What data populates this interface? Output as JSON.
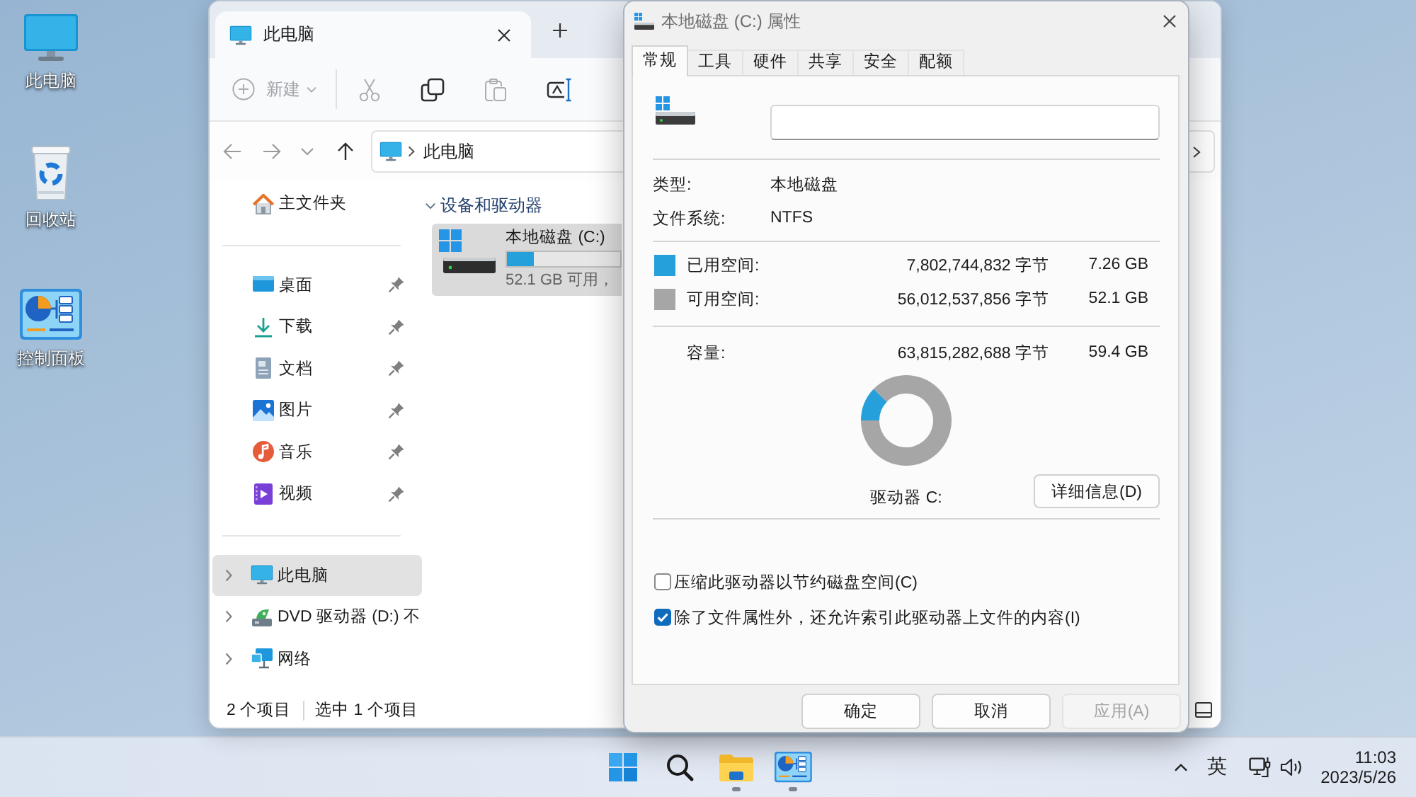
{
  "desktop": {
    "shortcuts": [
      {
        "label": "此电脑",
        "kind": "computer"
      },
      {
        "label": "回收站",
        "kind": "recycle-bin"
      },
      {
        "label": "控制面板",
        "kind": "control-panel"
      }
    ]
  },
  "explorer": {
    "tabs": [
      {
        "title": "此电脑",
        "selected": true
      }
    ],
    "toolbar": {
      "new": {
        "label": "新建",
        "disabled": true
      },
      "actions": [
        {
          "kind": "cut",
          "disabled": true
        },
        {
          "kind": "copy",
          "disabled": false
        },
        {
          "kind": "paste",
          "disabled": true
        },
        {
          "kind": "rename",
          "disabled": false
        }
      ]
    },
    "nav": [
      {
        "kind": "back",
        "disabled": true
      },
      {
        "kind": "forward",
        "disabled": true
      },
      {
        "kind": "recent",
        "disabled": true
      },
      {
        "kind": "up",
        "disabled": false
      }
    ],
    "address": {
      "path": "此电脑"
    },
    "sidebar": {
      "sections": [
        {
          "items": [
            {
              "label": "主文件夹",
              "kind": "home",
              "selected": false
            }
          ]
        },
        {
          "items": [
            {
              "label": "桌面",
              "kind": "desktop",
              "pinned": true,
              "selected": false
            },
            {
              "label": "下载",
              "kind": "downloads",
              "pinned": true,
              "selected": false
            },
            {
              "label": "文档",
              "kind": "documents",
              "pinned": true,
              "selected": false
            },
            {
              "label": "图片",
              "kind": "pictures",
              "pinned": true,
              "selected": false
            },
            {
              "label": "音乐",
              "kind": "music",
              "pinned": true,
              "selected": false
            },
            {
              "label": "视频",
              "kind": "videos",
              "pinned": true,
              "selected": false
            }
          ]
        },
        {
          "items": [
            {
              "label": "此电脑",
              "kind": "computer",
              "expanded": false,
              "selected": true
            },
            {
              "label": "DVD 驱动器 (D:) 不",
              "kind": "dvd",
              "expanded": false,
              "selected": false
            },
            {
              "label": "网络",
              "kind": "network",
              "expanded": false,
              "selected": false
            }
          ]
        }
      ]
    },
    "groups": [
      {
        "title": "设备和驱动器",
        "expanded": true,
        "drives": [
          {
            "name": "本地磁盘 (C:)",
            "free": "52.1 GB 可用，",
            "level": 0.24,
            "selected": true
          }
        ]
      }
    ],
    "status_bar": {
      "items": "2 个项目",
      "selection": "选中 1 个项目"
    }
  },
  "properties": {
    "title": "本地磁盘 (C:) 属性",
    "tabs": [
      {
        "label": "常规",
        "selected": true
      },
      {
        "label": "工具",
        "selected": false
      },
      {
        "label": "硬件",
        "selected": false
      },
      {
        "label": "共享",
        "selected": false
      },
      {
        "label": "安全",
        "selected": false
      },
      {
        "label": "配额",
        "selected": false
      }
    ],
    "info": [
      {
        "label": "类型:",
        "value": "本地磁盘"
      },
      {
        "label": "文件系统:",
        "value": "NTFS"
      }
    ],
    "space": [
      {
        "label": "已用空间:",
        "bytes": "7,802,744,832 字节",
        "size": "7.26 GB",
        "color": "#26a0da"
      },
      {
        "label": "可用空间:",
        "bytes": "56,012,537,856 字节",
        "size": "52.1 GB",
        "color": "#a6a6a6"
      }
    ],
    "capacity": {
      "label": "容量:",
      "bytes": "63,815,282,688 字节",
      "size": "59.4 GB"
    },
    "usage_ring": {
      "level": 0.122
    },
    "drive_label": "驱动器 C:",
    "details_button": "详细信息(D)",
    "options": [
      {
        "label": "压缩此驱动器以节约磁盘空间(C)",
        "checked": false
      },
      {
        "label": "除了文件属性外，还允许索引此驱动器上文件的内容(I)",
        "checked": true
      }
    ],
    "buttons": [
      {
        "label": "确定",
        "disabled": false
      },
      {
        "label": "取消",
        "disabled": false
      },
      {
        "label": "应用(A)",
        "disabled": true
      }
    ]
  },
  "taskbar": {
    "apps": [
      {
        "kind": "start",
        "running": false
      },
      {
        "kind": "search",
        "running": false
      },
      {
        "kind": "folder",
        "running": true
      },
      {
        "kind": "control-panel",
        "running": true
      }
    ],
    "tray": {
      "ime": "英"
    },
    "clock": {
      "time": "11:03",
      "date": "2023/5/26"
    }
  }
}
